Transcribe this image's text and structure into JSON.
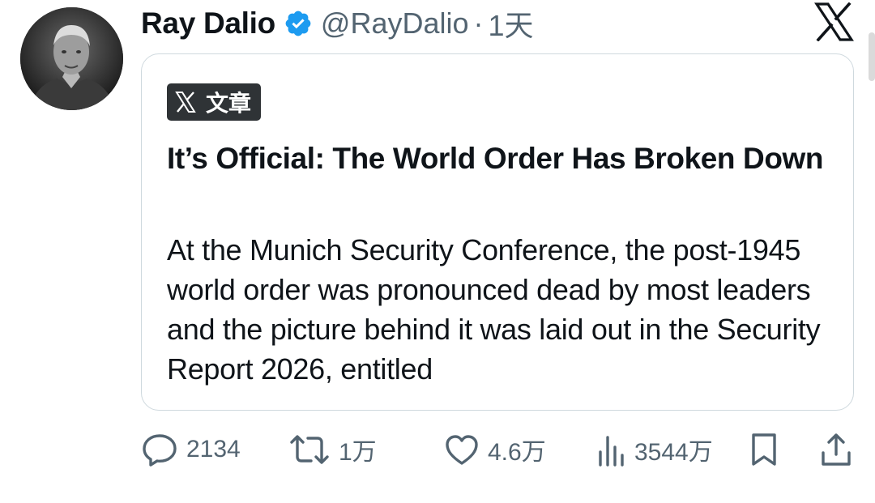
{
  "post": {
    "author_name": "Ray Dalio",
    "handle": "@RayDalio",
    "separator": "·",
    "time": "1天"
  },
  "article": {
    "badge_label": "文章",
    "title": "It’s Official: The World Order Has Broken Down",
    "excerpt": "At the Munich Security Conference, the post-1945 world order was pronounced dead by most leaders and the picture behind it was laid out in the Security Report 2026, entitled"
  },
  "actions": {
    "replies": "2134",
    "reposts": "1万",
    "likes": "4.6万",
    "views": "3544万"
  },
  "icons": {
    "brand": "x-logo-icon",
    "verified": "verified-badge-icon",
    "reply": "reply-icon",
    "repost": "repost-icon",
    "like": "heart-icon",
    "views": "views-icon",
    "bookmark": "bookmark-icon",
    "share": "share-icon"
  },
  "colors": {
    "verified_blue": "#1d9bf0",
    "secondary_text": "#536471",
    "badge_bg": "#2f3336",
    "card_border": "#cfd9de"
  }
}
